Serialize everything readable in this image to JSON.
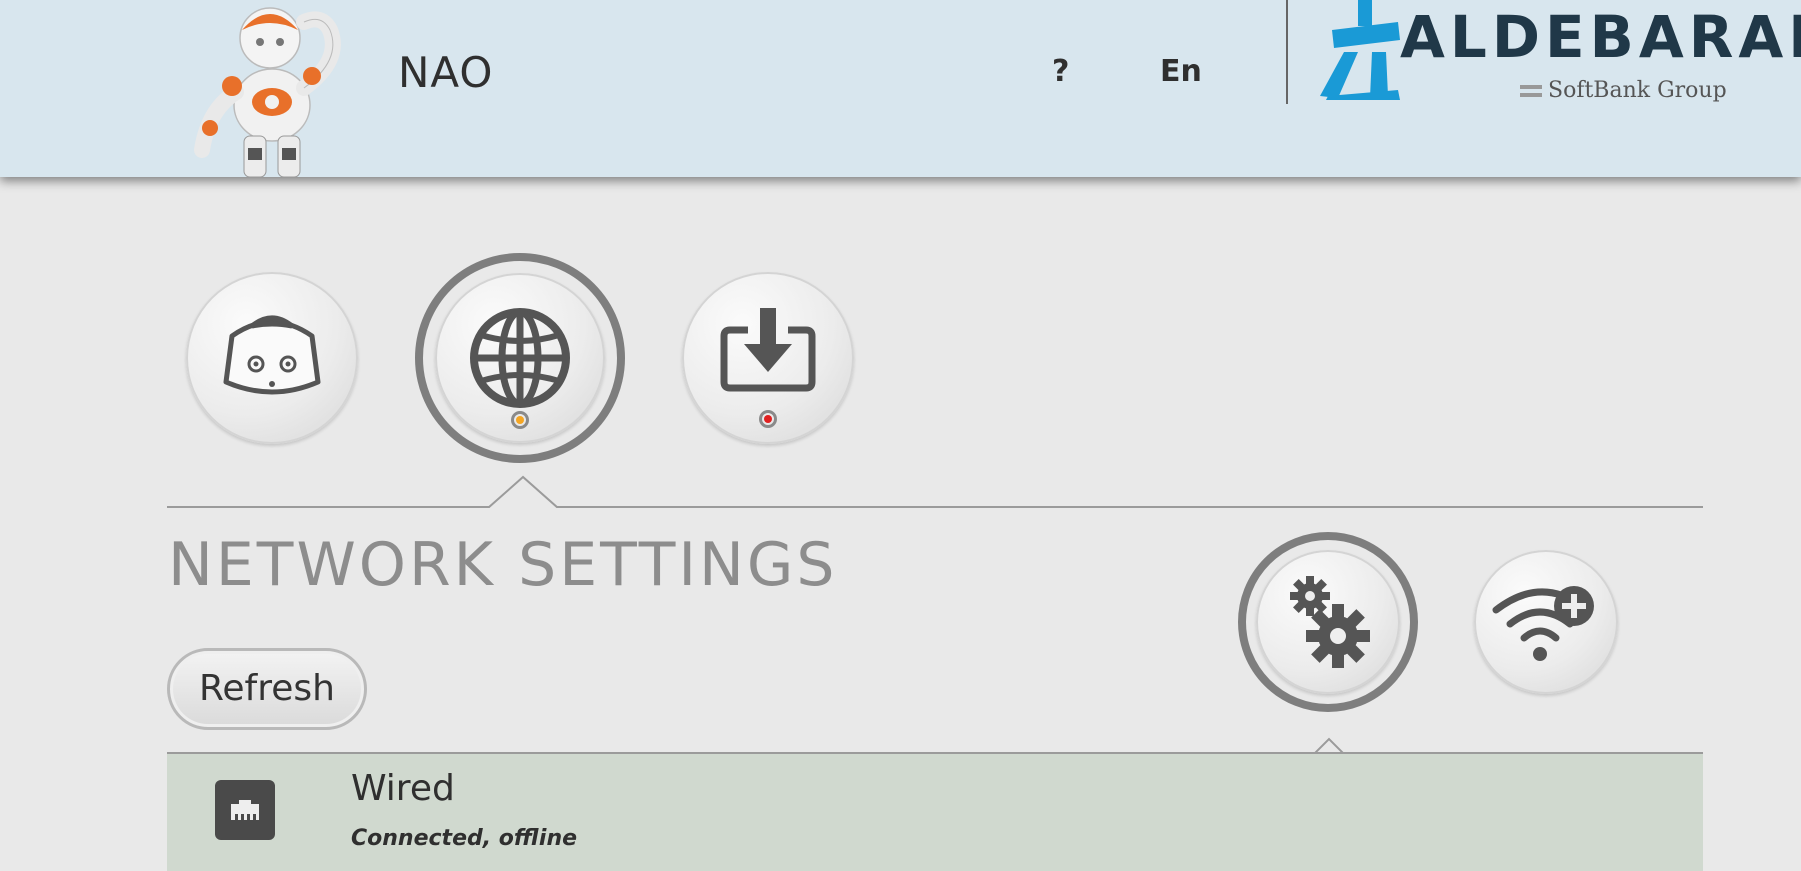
{
  "header": {
    "robot_name": "NAO",
    "help_label": "?",
    "language_label": "En",
    "brand": {
      "name": "ALDEBARAN",
      "sub": "SoftBank Group",
      "color": "#1a9ad6"
    }
  },
  "nav": {
    "items": [
      {
        "icon": "robot-face-icon",
        "selected": false,
        "status": null
      },
      {
        "icon": "globe-icon",
        "selected": true,
        "status": "#f5a623"
      },
      {
        "icon": "download-icon",
        "selected": false,
        "status": "#e02020"
      }
    ]
  },
  "network": {
    "title": "NETWORK SETTINGS",
    "refresh_label": "Refresh",
    "actions": [
      {
        "icon": "gears-icon",
        "selected": true
      },
      {
        "icon": "wifi-add-icon",
        "selected": false
      }
    ],
    "connections": [
      {
        "icon": "ethernet-icon",
        "name": "Wired",
        "status": "Connected, offline"
      }
    ]
  }
}
